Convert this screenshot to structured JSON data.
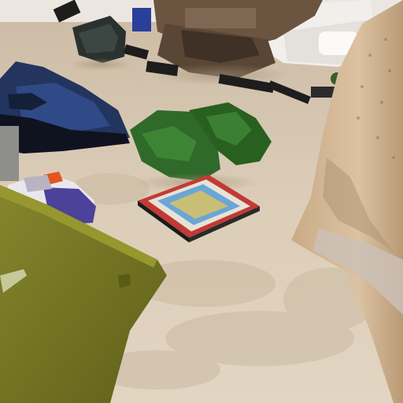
{
  "scene": {
    "kind": "3d-rendered-indoor-floor-view",
    "palette": {
      "floor": "#d9cab4",
      "floor_shadow": "#bfae96",
      "wall": "#e9e4dc",
      "sofa": "#f2f0ec",
      "table_wood": "#6b5540",
      "shoe_blue": "#22345e",
      "gloves_green": "#2f6a2a",
      "case_red": "#c23a34",
      "cushion_olive": "#7a7b25",
      "beige_object": "#d2b695",
      "dark_items": "#1d1d1d",
      "sneaker_purple": "#5a4fa0"
    },
    "objects": [
      "coffee-table",
      "white-sofa",
      "backpack",
      "blue-shoe",
      "green-gloves",
      "game-case",
      "olive-cushion",
      "beige-object",
      "sneaker",
      "cables"
    ]
  }
}
